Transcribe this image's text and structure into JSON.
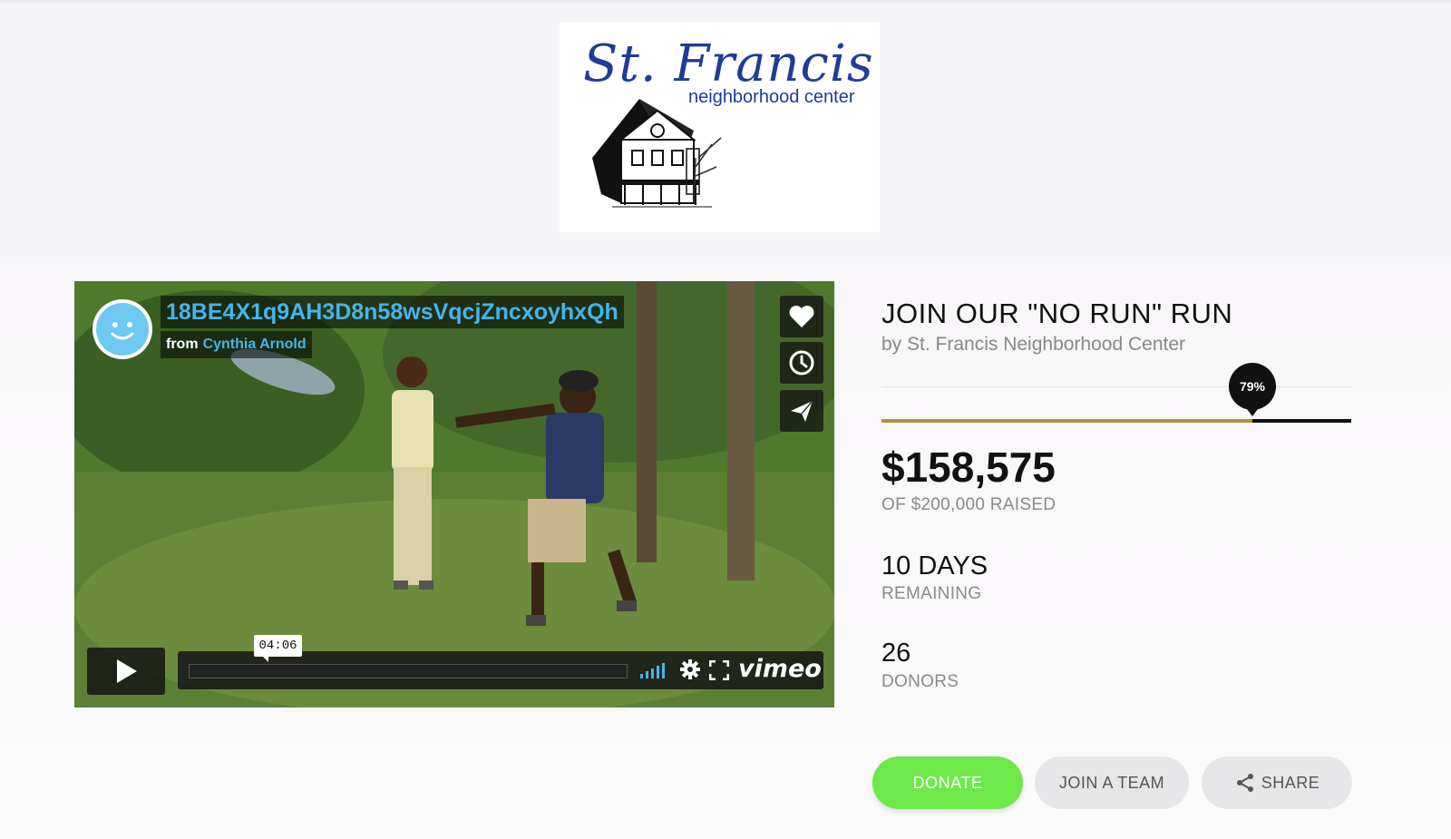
{
  "logo": {
    "title": "St. Francis",
    "subtitle": "neighborhood center"
  },
  "video": {
    "title": "18BE4X1q9AH3D8n58wsVqcjZncxoyhxQh",
    "from_label": "from",
    "author": "Cynthia Arnold",
    "time": "04:06",
    "brand": "vimeo",
    "side_buttons": [
      "heart-icon",
      "clock-icon",
      "send-icon"
    ]
  },
  "campaign": {
    "title": "JOIN OUR \"NO RUN\" RUN",
    "organizer": "by St. Francis Neighborhood Center",
    "progress_percent": 79,
    "progress_label": "79%",
    "raised": "$158,575",
    "raised_label": "OF $200,000 RAISED",
    "days": "10 DAYS",
    "days_label": "REMAINING",
    "donors": "26",
    "donors_label": "DONORS"
  },
  "actions": {
    "donate": "DONATE",
    "join_team": "JOIN A TEAM",
    "share": "SHARE"
  },
  "colors": {
    "progress_fill": "#b08f3e",
    "donate": "#6fe94a",
    "video_accent": "#44b4ee"
  }
}
